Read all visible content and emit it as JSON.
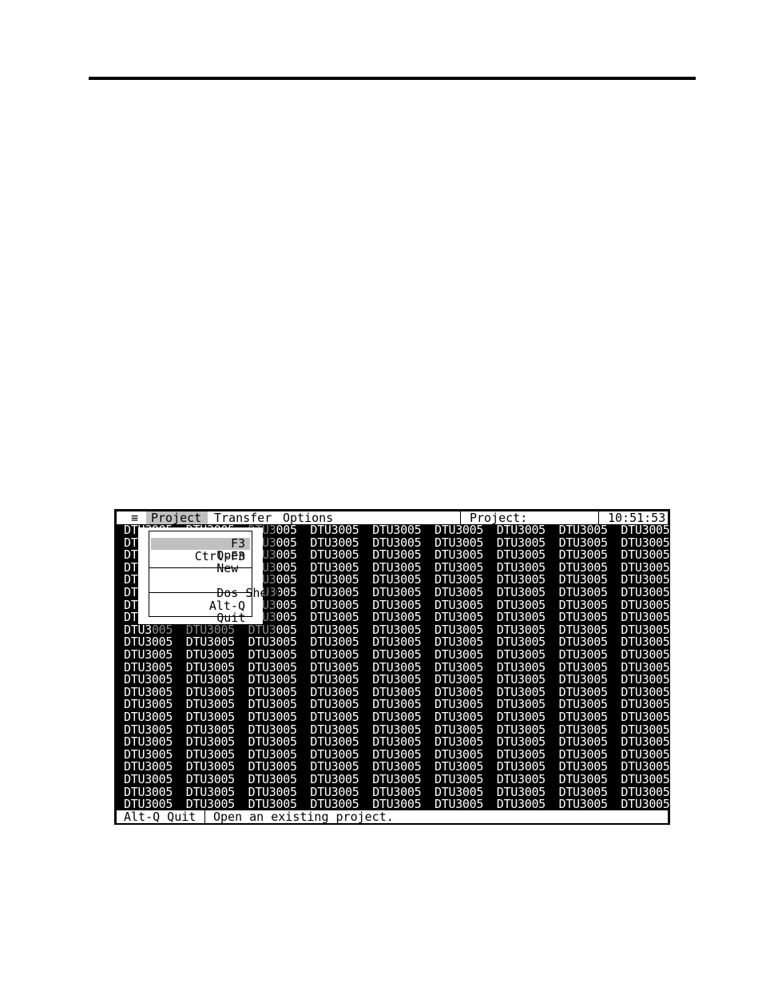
{
  "menubar": {
    "system_icon": "≡",
    "items": [
      {
        "label": "Project",
        "active": true
      },
      {
        "label": "Transfer",
        "active": false
      },
      {
        "label": "Options",
        "active": false
      }
    ],
    "project_label": "Project:",
    "project_value": "",
    "clock": "10:51:53"
  },
  "dropdown": {
    "items": [
      {
        "label": "Open",
        "shortcut": "F3",
        "selected": true
      },
      {
        "label": "New",
        "shortcut": "Ctrl-F3",
        "selected": false
      },
      {
        "label": "Dos Shell",
        "shortcut": "",
        "selected": false
      },
      {
        "label": "Quit",
        "shortcut": "Alt-Q",
        "selected": false
      }
    ]
  },
  "grid": {
    "cell_text": "DTU3005",
    "columns": 9,
    "rows": 23
  },
  "statusbar": {
    "shortcut_hint": "Alt-Q Quit",
    "message": "Open an existing project."
  }
}
